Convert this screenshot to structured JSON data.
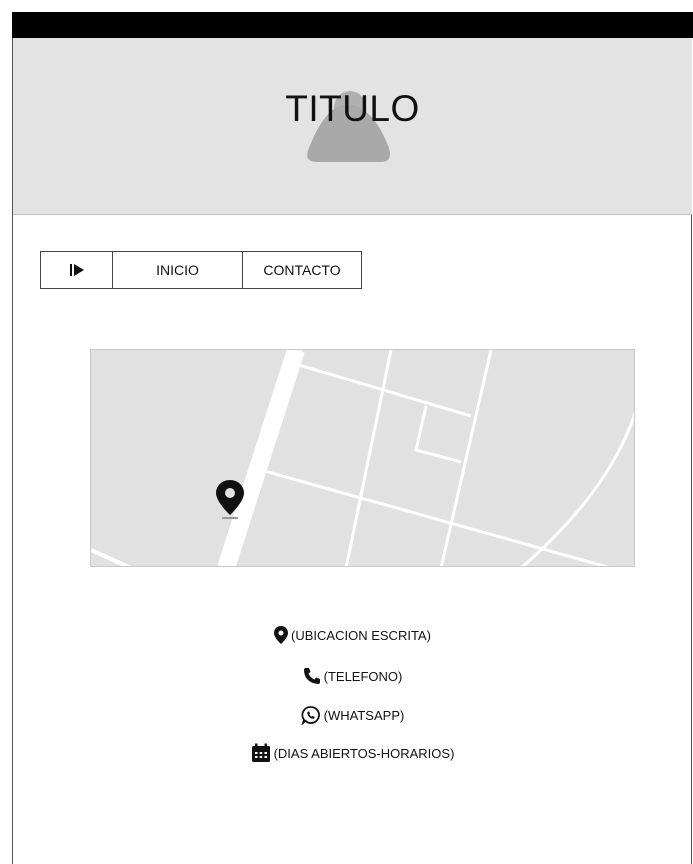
{
  "header": {
    "title": "TITULO"
  },
  "nav": {
    "items": [
      {
        "label": "",
        "icon": "play-toggle-icon"
      },
      {
        "label": "INICIO"
      },
      {
        "label": "CONTACTO"
      }
    ]
  },
  "map": {
    "marker_icon": "map-pin-icon"
  },
  "info": {
    "location": "(UBICACION ESCRITA)",
    "phone": "(TELEFONO)",
    "whatsapp": "(WHATSAPP)",
    "hours": "(DIAS ABIERTOS-HORARIOS)"
  },
  "colors": {
    "topbar": "#000000",
    "header_bg": "#e3e3e3",
    "map_bg": "#e1e1e1",
    "road": "#ffffff"
  }
}
